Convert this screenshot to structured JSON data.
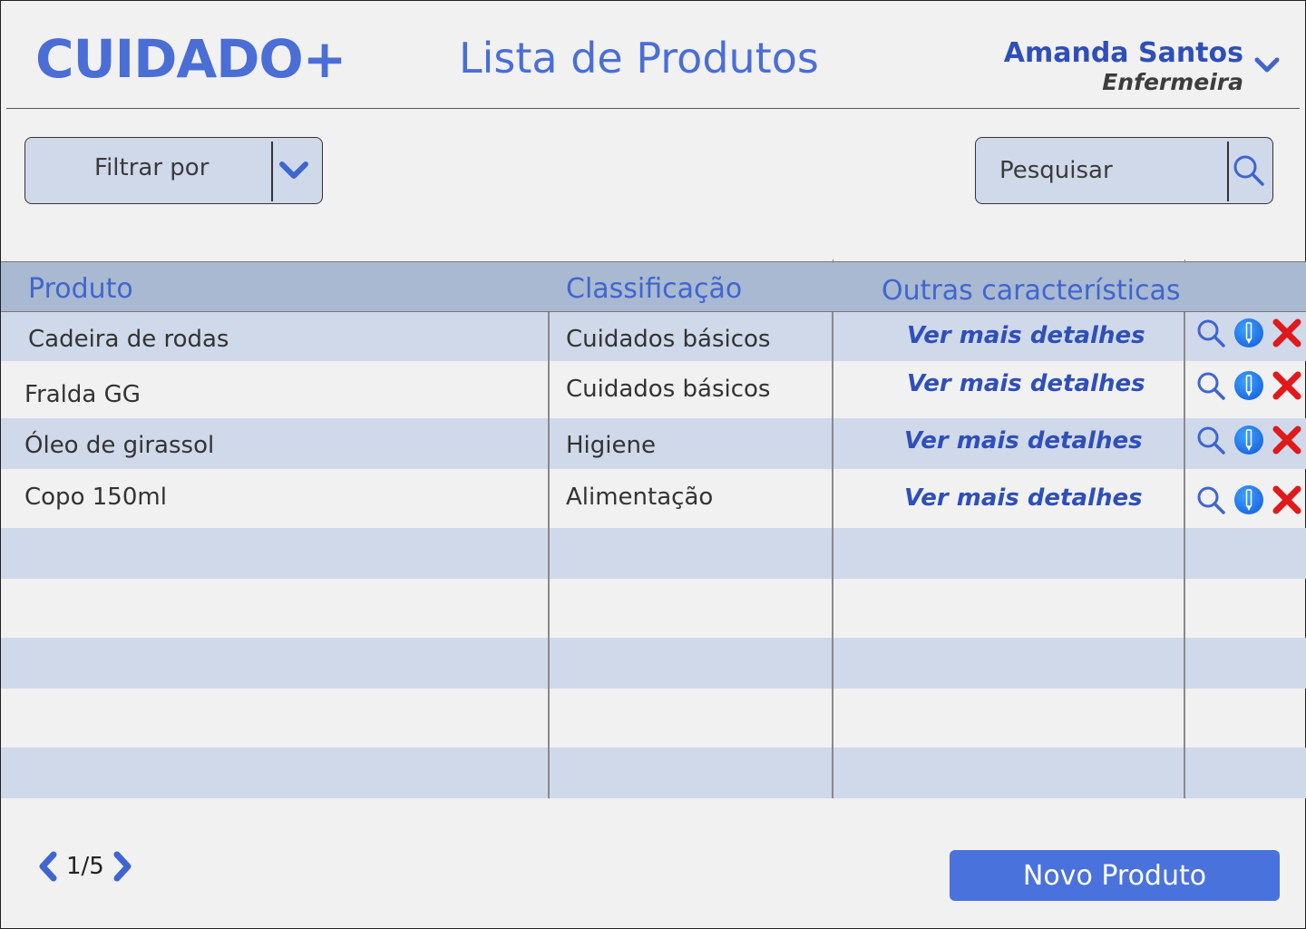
{
  "header": {
    "app_title": "CUIDADO+",
    "page_title": "Lista de  Produtos",
    "user": {
      "name": "Amanda Santos",
      "role": "Enfermeira"
    }
  },
  "filter": {
    "label": "Filtrar por"
  },
  "search": {
    "placeholder": "Pesquisar"
  },
  "table": {
    "columns": [
      "Produto",
      "Classificação",
      "Outras características"
    ],
    "rows": [
      {
        "produto": "Cadeira de rodas",
        "classificacao": "Cuidados básicos",
        "link": "Ver mais detalhes"
      },
      {
        "produto": "Fralda GG",
        "classificacao": "Cuidados básicos",
        "link": "Ver mais detalhes"
      },
      {
        "produto": "Óleo de girassol",
        "classificacao": "Higiene",
        "link": "Ver mais detalhes"
      },
      {
        "produto": "Copo 150ml",
        "classificacao": "Alimentação",
        "link": "Ver mais detalhes"
      }
    ],
    "row_actions": [
      "search-icon",
      "edit-icon",
      "delete-icon"
    ]
  },
  "pagination": {
    "text": "1/5"
  },
  "new_button": {
    "label": "Novo Produto"
  },
  "colors": {
    "accent": "#4a6ed6",
    "header_bg": "#a9b9d2",
    "row_shade": "#cfd9ea",
    "page_bg": "#f1f1f2",
    "delete": "#e0191b",
    "edit": "#1a66e0"
  }
}
